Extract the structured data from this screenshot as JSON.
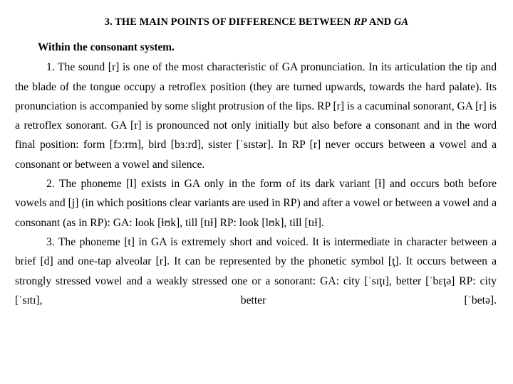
{
  "document": {
    "title": {
      "prefix": "3. THE MAIN POINTS OF DIFFERENCE BETWEEN ",
      "italic_1": "RP",
      "middle": " AND ",
      "italic_2": "GA"
    },
    "lead_in": "Within the consonant system.",
    "paragraphs": [
      "1. The sound [r] is one of the most characteristic of GA pronunciation. In its articulation the tip and the blade of the tongue occupy a retroflex position (they are turned upwards, towards the hard palate). Its pronunciation is accompanied by some slight protrusion of the lips. RP [r] is a cacuminal sonorant, GA [r] is a retroflex sonorant. GA [r] is pronounced not only initially but also before a consonant and in the word final position: form [fɔːrm], bird [bɜːrd], sister [ˈsɪstər]. In RP [r] never occurs between a vowel and a consonant or between a vowel and silence.",
      "2. The phoneme [l] exists in GA only in the form of its dark variant [ɫ] and occurs both before vowels and [j] (in which positions clear variants are used in RP) and after a vowel or between a vowel and a consonant (as in RP): GA: look [ɫʊk], till [tɪɫ] RP: look [lʊk], till [tɪɫ].",
      "3. The phoneme [t] in GA is extremely short and voiced. It is intermediate in character between a brief [d] and one-tap alveolar [r]. It can be represented by the phonetic symbol [ţ]. It occurs between a strongly stressed vowel and a weakly stressed one or a sonorant: GA: city [ˈsɪţɪ], better [ˈbɛţə] RP: city [ˈsɪtɪ], better [ˈbetə]."
    ]
  }
}
